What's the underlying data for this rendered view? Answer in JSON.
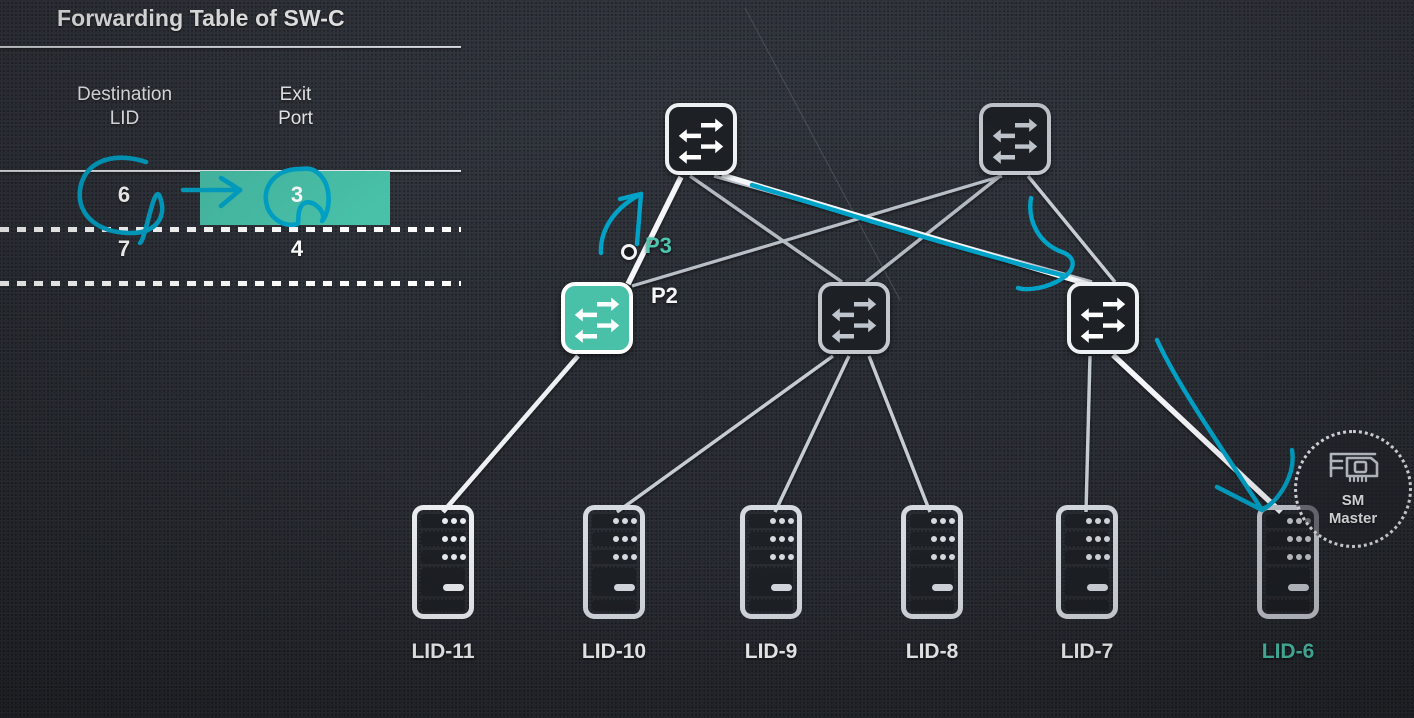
{
  "palette": {
    "background": "#2b2f36",
    "accent_teal": "#49c1a9",
    "annotation_cyan": "#00a3c8",
    "link_bright": "#f2f4f7",
    "link_dim": "#b9bfc7",
    "text_white": "#f3f5f7"
  },
  "table": {
    "title": "Forwarding Table of SW-C",
    "columns": [
      {
        "id": "dest",
        "header_line1": "Destination",
        "header_line2": "LID"
      },
      {
        "id": "exit",
        "header_line1": "Exit",
        "header_line2": "Port"
      }
    ],
    "rows": [
      {
        "destination_lid": "6",
        "exit_port": "3",
        "highlighted": true,
        "circled": true
      },
      {
        "destination_lid": "7",
        "exit_port": "4",
        "highlighted": false,
        "circled": false
      }
    ]
  },
  "topology": {
    "spine_switches": [
      {
        "id": "spine-left",
        "name": "spine-switch-left",
        "state": "bright"
      },
      {
        "id": "spine-right",
        "name": "spine-switch-right",
        "state": "dim"
      }
    ],
    "leaf_switches": [
      {
        "id": "leaf-sw-c",
        "name": "leaf-switch-sw-c",
        "state": "active-teal"
      },
      {
        "id": "leaf-mid",
        "name": "leaf-switch-middle",
        "state": "dim"
      },
      {
        "id": "leaf-right",
        "name": "leaf-switch-right",
        "state": "bright"
      }
    ],
    "port_markers": [
      {
        "id": "p3",
        "label": "P3",
        "highlighted": true
      },
      {
        "id": "p2",
        "label": "P2",
        "highlighted": false
      }
    ],
    "hosts": [
      {
        "id": "lid-11",
        "label": "LID-11",
        "highlighted": false
      },
      {
        "id": "lid-10",
        "label": "LID-10",
        "highlighted": false
      },
      {
        "id": "lid-9",
        "label": "LID-9",
        "highlighted": false
      },
      {
        "id": "lid-8",
        "label": "LID-8",
        "highlighted": false
      },
      {
        "id": "lid-7",
        "label": "LID-7",
        "highlighted": false
      },
      {
        "id": "lid-6",
        "label": "LID-6",
        "highlighted": true
      }
    ],
    "sm_badge": {
      "line1": "SM",
      "line2": "Master",
      "icon": "hca-network-card-icon"
    }
  },
  "annotations": {
    "circle_dest_lid": "hand-drawn circle around destination LID 6",
    "circle_exit_port": "hand-drawn circle around exit port 3",
    "arrow_table": "hand-drawn arrow from LID column to exit port column",
    "arrow_p3": "hand-drawn arrow pointing up to port P3 link",
    "loop_spine_right": "hand-drawn loop near right spine switch",
    "arrow_to_lid6": "hand-drawn arrow pointing down to LID-6 host"
  }
}
